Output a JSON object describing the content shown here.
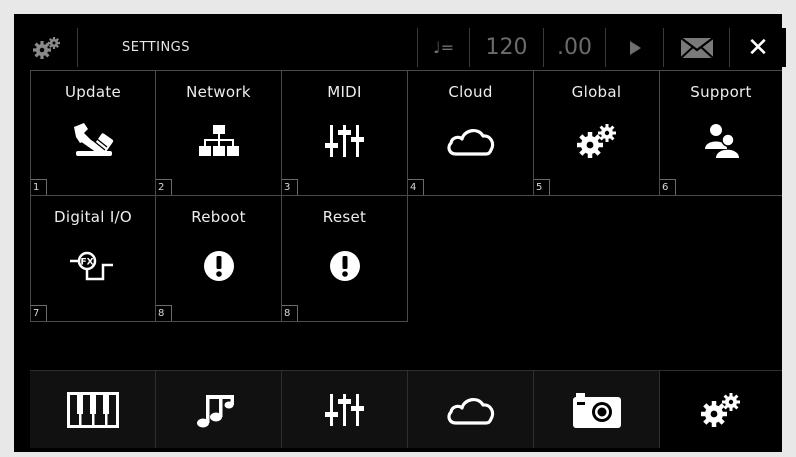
{
  "topbar": {
    "title": "SETTINGS",
    "tempo_symbol": "♩=",
    "tempo_value": "120",
    "tempo_fraction": ".00",
    "close_glyph": "✕"
  },
  "tiles": [
    {
      "label": "Update",
      "number": "1",
      "icon": "wrench-icon"
    },
    {
      "label": "Network",
      "number": "2",
      "icon": "network-icon"
    },
    {
      "label": "MIDI",
      "number": "3",
      "icon": "sliders-icon"
    },
    {
      "label": "Cloud",
      "number": "4",
      "icon": "cloud-icon"
    },
    {
      "label": "Global",
      "number": "5",
      "icon": "gears-icon"
    },
    {
      "label": "Support",
      "number": "6",
      "icon": "users-icon"
    },
    {
      "label": "Digital I/O",
      "number": "7",
      "icon": "digital-io-icon"
    },
    {
      "label": "Reboot",
      "number": "8",
      "icon": "alert-icon"
    },
    {
      "label": "Reset",
      "number": "8",
      "icon": "alert-icon"
    }
  ],
  "bottom_nav": [
    {
      "name": "keyboard",
      "icon": "piano-icon",
      "active": false
    },
    {
      "name": "music",
      "icon": "music-notes-icon",
      "active": false
    },
    {
      "name": "mixer",
      "icon": "sliders-icon",
      "active": false
    },
    {
      "name": "cloud",
      "icon": "cloud-icon",
      "active": false
    },
    {
      "name": "camera",
      "icon": "camera-icon",
      "active": false
    },
    {
      "name": "settings",
      "icon": "gears-icon",
      "active": true
    }
  ],
  "colors": {
    "background": "#000000",
    "frame": "#e8e8e8",
    "grid_line": "#4a4a4a",
    "text": "#ededed",
    "dim_text": "#6b6b6b"
  }
}
